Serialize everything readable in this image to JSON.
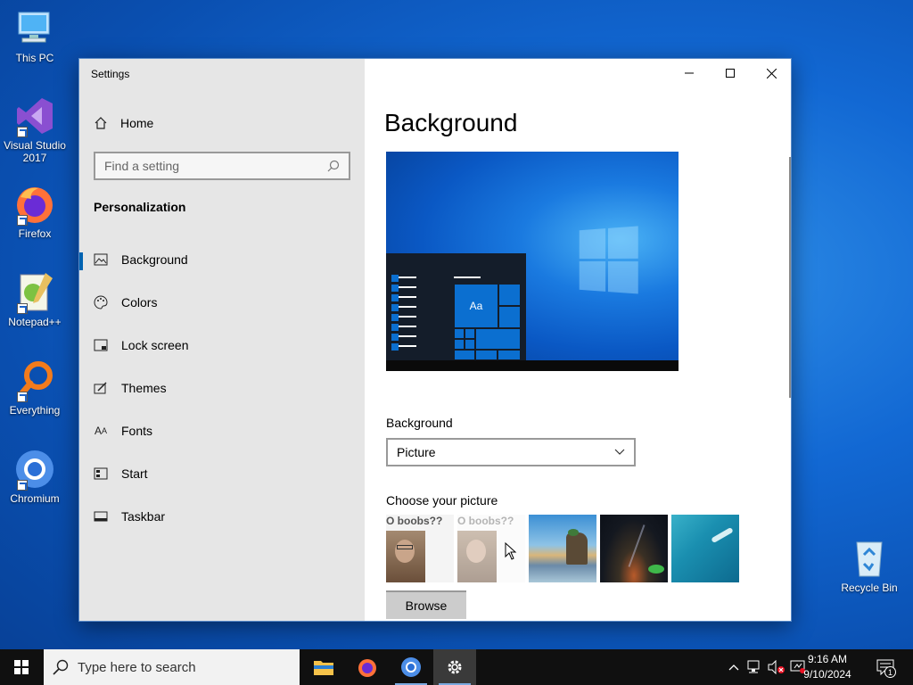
{
  "desktop": {
    "icons": [
      {
        "label": "This PC"
      },
      {
        "label": "Visual Studio 2017"
      },
      {
        "label": "Firefox"
      },
      {
        "label": "Notepad++"
      },
      {
        "label": "Everything"
      },
      {
        "label": "Chromium"
      },
      {
        "label": "Recycle Bin"
      }
    ]
  },
  "window": {
    "title": "Settings",
    "sidebar": {
      "home_label": "Home",
      "search_placeholder": "Find a setting",
      "section_label": "Personalization",
      "items": [
        {
          "label": "Background",
          "icon": "picture-icon",
          "active": true
        },
        {
          "label": "Colors",
          "icon": "palette-icon"
        },
        {
          "label": "Lock screen",
          "icon": "lock-screen-icon"
        },
        {
          "label": "Themes",
          "icon": "brush-icon"
        },
        {
          "label": "Fonts",
          "icon": "font-icon"
        },
        {
          "label": "Start",
          "icon": "start-icon"
        },
        {
          "label": "Taskbar",
          "icon": "taskbar-icon"
        }
      ]
    },
    "main": {
      "title": "Background",
      "preview_tile_text": "Aa",
      "background_label": "Background",
      "background_value": "Picture",
      "choose_label": "Choose your picture",
      "thumb_caption": "O boobs??",
      "browse_label": "Browse"
    }
  },
  "taskbar": {
    "search_placeholder": "Type here to search",
    "time": "9:16 AM",
    "date": "9/10/2024",
    "notification_count": "1"
  },
  "colors": {
    "accent": "#0063b1",
    "sidebar_bg": "#e6e6e6",
    "taskbar_bg": "#101010"
  }
}
